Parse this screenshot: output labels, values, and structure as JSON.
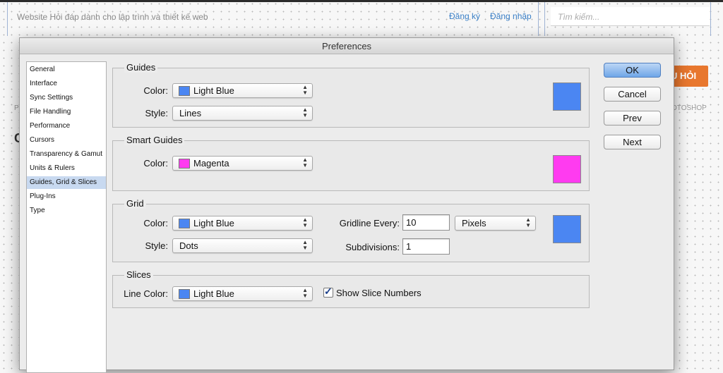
{
  "website": {
    "title": "Website Hỏi đáp dành cho lập trình và thiết kế web",
    "links": [
      "Đăng ký",
      "Đăng nhập"
    ],
    "search_placeholder": "Tìm kiếm...",
    "ask_button": "U HỎI",
    "menu_fragment": "OTOSHOP",
    "frag_p": "P",
    "frag_c": "C"
  },
  "dialog": {
    "title": "Preferences",
    "categories": [
      "General",
      "Interface",
      "Sync Settings",
      "File Handling",
      "Performance",
      "Cursors",
      "Transparency & Gamut",
      "Units & Rulers",
      "Guides, Grid & Slices",
      "Plug-Ins",
      "Type"
    ],
    "selected_category": "Guides, Grid & Slices",
    "buttons": {
      "ok": "OK",
      "cancel": "Cancel",
      "prev": "Prev",
      "next": "Next"
    },
    "guides": {
      "title": "Guides",
      "color_label": "Color:",
      "color_value": "Light Blue",
      "color_hex": "#4b86f2",
      "style_label": "Style:",
      "style_value": "Lines"
    },
    "smart_guides": {
      "title": "Smart Guides",
      "color_label": "Color:",
      "color_value": "Magenta",
      "color_hex": "#ff3bf0"
    },
    "grid": {
      "title": "Grid",
      "color_label": "Color:",
      "color_value": "Light Blue",
      "color_hex": "#4b86f2",
      "style_label": "Style:",
      "style_value": "Dots",
      "gridline_label": "Gridline Every:",
      "gridline_value": "10",
      "units_value": "Pixels",
      "subdivisions_label": "Subdivisions:",
      "subdivisions_value": "1"
    },
    "slices": {
      "title": "Slices",
      "line_color_label": "Line Color:",
      "line_color_value": "Light Blue",
      "color_hex": "#4b86f2",
      "show_numbers_label": "Show Slice Numbers",
      "show_numbers_checked": true
    }
  }
}
